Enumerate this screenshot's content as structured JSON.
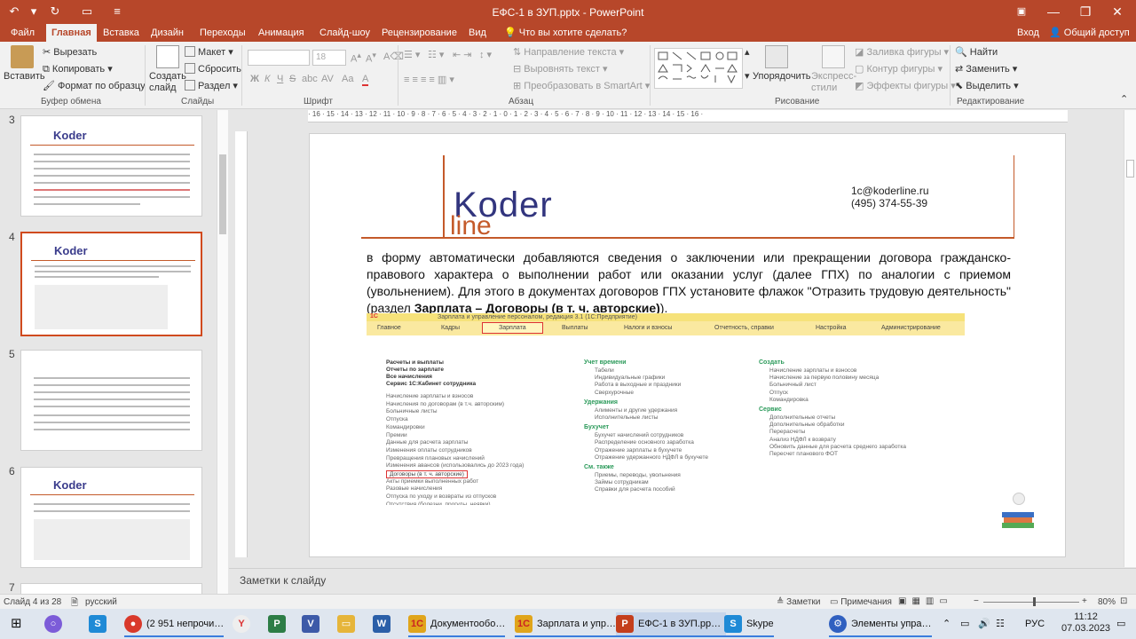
{
  "window": {
    "title": "ЕФС-1 в ЗУП.pptx - PowerPoint",
    "sign_in": "Вход",
    "share": "Общий доступ"
  },
  "tabs": [
    "Файл",
    "Главная",
    "Вставка",
    "Дизайн",
    "Переходы",
    "Анимация",
    "Слайд-шоу",
    "Рецензирование",
    "Вид"
  ],
  "tell_me": "Что вы хотите сделать?",
  "ribbon": {
    "clipboard": {
      "paste": "Вставить",
      "cut": "Вырезать",
      "copy": "Копировать",
      "format_painter": "Формат по образцу",
      "label": "Буфер обмена"
    },
    "slides": {
      "new_slide": "Создать слайд",
      "layout": "Макет",
      "reset": "Сбросить",
      "section": "Раздел",
      "label": "Слайды"
    },
    "font": {
      "size": "18",
      "label": "Шрифт",
      "bold": "Ж",
      "italic": "К",
      "underline": "Ч",
      "strike": "S",
      "shadow": "abc",
      "spacing": "AV",
      "case": "Aa",
      "color": "A"
    },
    "paragraph": {
      "text_direction": "Направление текста",
      "align_text": "Выровнять текст",
      "smartart": "Преобразовать в SmartArt",
      "label": "Абзац"
    },
    "drawing": {
      "arrange": "Упорядочить",
      "quick_styles": "Экспресс-стили",
      "shape_fill": "Заливка фигуры",
      "shape_outline": "Контур фигуры",
      "shape_effects": "Эффекты фигуры",
      "label": "Рисование"
    },
    "editing": {
      "find": "Найти",
      "replace": "Заменить",
      "select": "Выделить",
      "label": "Редактирование"
    }
  },
  "thumbnails": [
    "3",
    "4",
    "5",
    "6",
    "7"
  ],
  "ruler_h": "· 16 · 15 · 14 · 13 · 12 · 11 · 10 · 9 · 8 · 7 · 6 · 5 · 4 · 3 · 2 · 1 · 0 · 1 · 2 · 3 · 4 · 5 · 6 · 7 · 8 · 9 · 10 · 11 · 12 · 13 · 14 · 15 · 16 ·",
  "slide": {
    "logo_top": "Koder",
    "logo_bottom": "line",
    "email": "1c@koderline.ru",
    "phone": "(495) 374-55-39",
    "paragraph_start": "в форму автоматически добавляются сведения о заключении или прекращении договора гражданско-правового характера о выполнении работ или оказании услуг (далее ГПХ) по аналогии с приемом (увольнением). Для этого в документах договоров ГПХ установите флажок \"Отразить трудовую деятельность\" (раздел ",
    "paragraph_bold": "Зарплата – Договоры (в т. ч. авторские)",
    "paragraph_end": ").",
    "screenshot": {
      "title": "Зарплата и управление персоналом, редакция 3.1 (1С:Предприятие)",
      "menu": [
        "Главное",
        "Кадры",
        "Зарплата",
        "Выплаты",
        "Налоги и взносы",
        "Отчетность, справки",
        "Настройка",
        "Администрирование"
      ],
      "col1_head": [
        "Расчеты и выплаты",
        "Отчеты по зарплате",
        "Все начисления",
        "Сервис 1С:Кабинет сотрудника"
      ],
      "col1": [
        "Начисление зарплаты и взносов",
        "Начисления по договорам (в т.ч. авторским)",
        "Больничные листы",
        "Отпуска",
        "Командировки",
        "Премии",
        "Данные для расчета зарплаты",
        "Изменения оплаты сотрудников",
        "Превращения плановых начислений",
        "Изменения авансов (использовались до 2023 года)",
        "Договоры (в т. ч. авторские)",
        "Акты приемки выполненных работ",
        "Разовые начисления",
        "Отпуска по уходу и возвраты из отпусков",
        "Отсутствия (болезни, прогулы, неявки)"
      ],
      "col2_groups": [
        {
          "title": "Учет времени",
          "items": [
            "Табели",
            "Индивидуальные графики",
            "Работа в выходные и праздники",
            "Сверхурочные"
          ]
        },
        {
          "title": "Удержания",
          "items": [
            "Алименты и другие удержания",
            "Исполнительные листы"
          ]
        },
        {
          "title": "Бухучет",
          "items": [
            "Бухучет начислений сотрудников",
            "Распределение основного заработка",
            "Отражение зарплаты в бухучете",
            "Отражение удержанного НДФЛ в бухучете"
          ]
        },
        {
          "title": "См. также",
          "items": [
            "Приемы, переводы, увольнения",
            "Займы сотрудникам",
            "Справки для расчета пособий"
          ]
        }
      ],
      "col3_groups": [
        {
          "title": "Создать",
          "items": [
            "Начисление зарплаты и взносов",
            "Начисление за первую половину месяца",
            "Больничный лист",
            "Отпуск",
            "Командировка"
          ]
        },
        {
          "title": "Сервис",
          "items": [
            "Дополнительные отчеты",
            "Дополнительные обработки",
            "Перерасчеты",
            "Анализ НДФЛ к возврату",
            "Обновить данные для расчета среднего заработка",
            "Пересчет планового ФОТ"
          ]
        }
      ]
    }
  },
  "notes_placeholder": "Заметки к слайду",
  "status": {
    "slide_counter": "Слайд 4 из 28",
    "language": "русский",
    "notes": "Заметки",
    "comments": "Примечания",
    "zoom": "80%"
  },
  "taskbar": {
    "items": [
      {
        "label": "(2 951 непрочи…",
        "color": "#d9392b"
      },
      {
        "label": "Документообо…",
        "color": "#e0a51b"
      },
      {
        "label": "Зарплата и упр…",
        "color": "#e0a51b"
      },
      {
        "label": "ЕФС-1 в ЗУП.pp…",
        "color": "#c43e1c"
      },
      {
        "label": "Skype",
        "color": "#1f8ad6"
      },
      {
        "label": "Элементы упра…",
        "color": "#3060c0"
      }
    ],
    "lang": "РУС",
    "time": "11:12",
    "date": "07.03.2023"
  }
}
